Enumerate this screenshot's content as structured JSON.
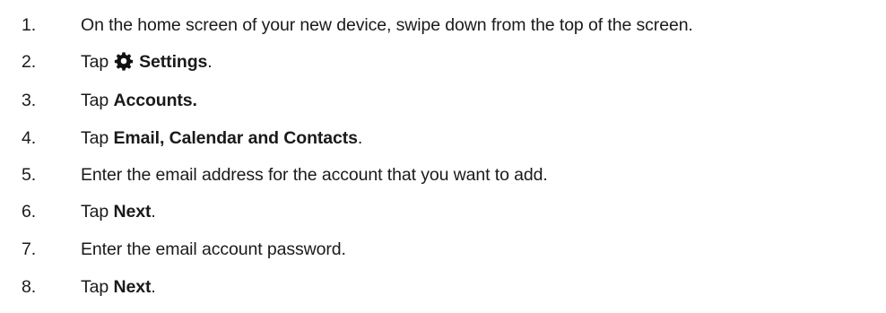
{
  "steps": [
    {
      "number": "1.",
      "text": "On the home screen of your new device, swipe down from the top of the screen."
    },
    {
      "number": "2.",
      "prefix": "Tap",
      "icon": "gear-icon",
      "bold": "Settings",
      "suffix": "."
    },
    {
      "number": "3.",
      "prefix": "Tap ",
      "bold": "Accounts."
    },
    {
      "number": "4.",
      "prefix": "Tap ",
      "bold": "Email, Calendar and Contacts",
      "suffix": "."
    },
    {
      "number": "5.",
      "text": "Enter the email address for the account that you want to add."
    },
    {
      "number": "6.",
      "prefix": "Tap ",
      "bold": "Next",
      "suffix": "."
    },
    {
      "number": "7.",
      "text": "Enter the email account password."
    },
    {
      "number": "8.",
      "prefix": "Tap ",
      "bold": "Next",
      "suffix": "."
    }
  ]
}
